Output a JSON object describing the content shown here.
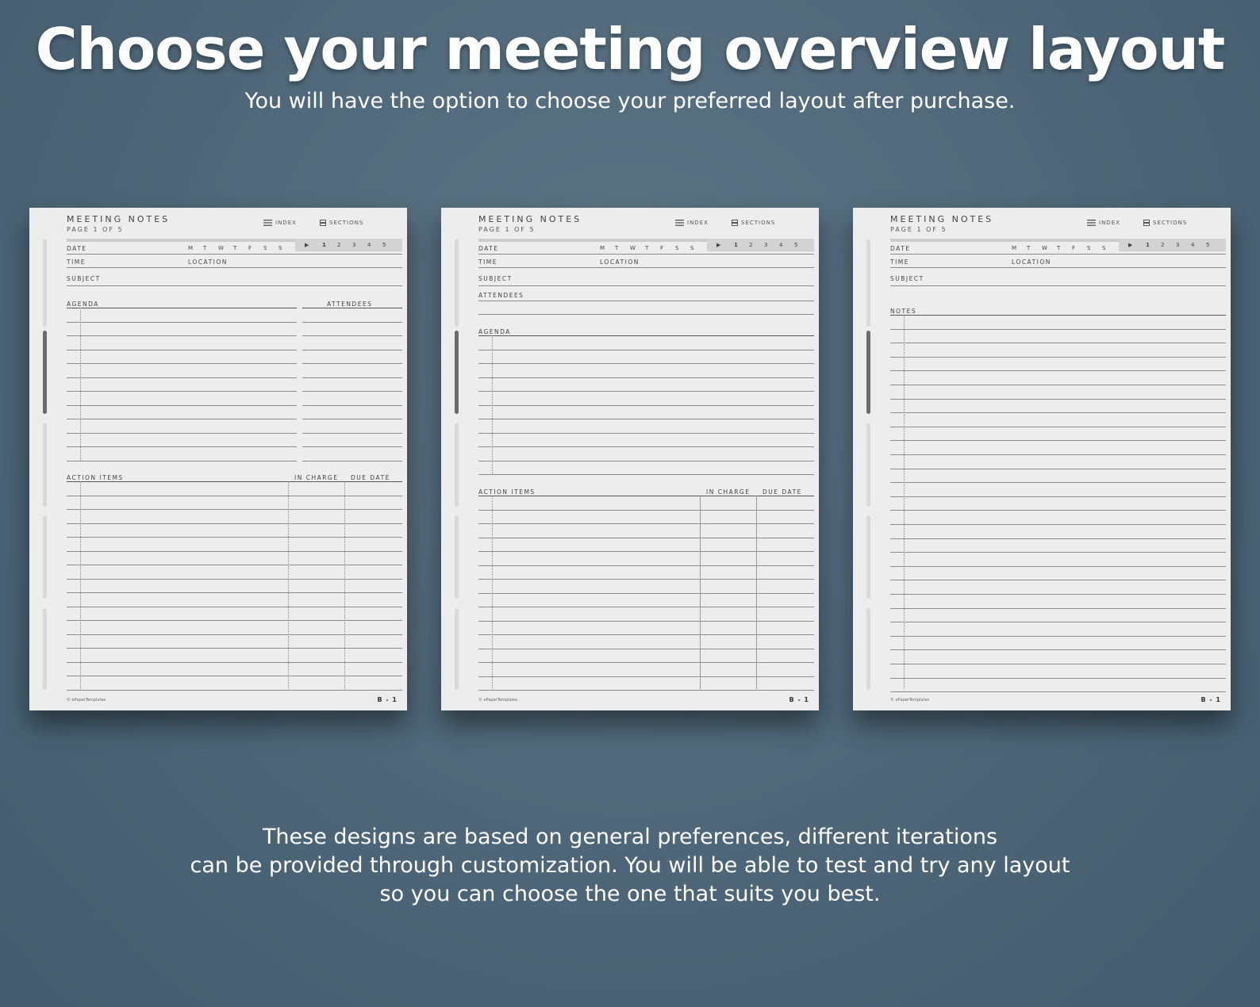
{
  "headline": "Choose your meeting overview layout",
  "subline": "You will have the option to choose your preferred layout after purchase.",
  "footer_lines": [
    "These designs are based on general preferences, different iterations",
    "can be provided through customization. You will be able to test and try any layout",
    "so you can choose the one that suits you best."
  ],
  "common": {
    "title": "MEETING NOTES",
    "page": "PAGE 1 OF 5",
    "index_label": "INDEX",
    "sections_label": "SECTIONS",
    "date_label": "DATE",
    "time_label": "TIME",
    "location_label": "LOCATION",
    "subject_label": "SUBJECT",
    "days": [
      "M",
      "T",
      "W",
      "T",
      "F",
      "S",
      "S"
    ],
    "play_glyph": "▶",
    "page_tabs": [
      "1",
      "2",
      "3",
      "4",
      "5"
    ],
    "copyright": "© ePaperTemplates",
    "page_code": "B - 1"
  },
  "layouts": [
    {
      "name": "agenda-attendees-actions",
      "agenda_label": "AGENDA",
      "attendees_label": "ATTENDEES",
      "action_items_label": "ACTION ITEMS",
      "in_charge_label": "IN CHARGE",
      "due_date_label": "DUE DATE"
    },
    {
      "name": "attendees-agenda-actions",
      "attendees_label": "ATTENDEES",
      "agenda_label": "AGENDA",
      "action_items_label": "ACTION ITEMS",
      "in_charge_label": "IN CHARGE",
      "due_date_label": "DUE DATE"
    },
    {
      "name": "notes-only",
      "notes_label": "NOTES"
    }
  ]
}
